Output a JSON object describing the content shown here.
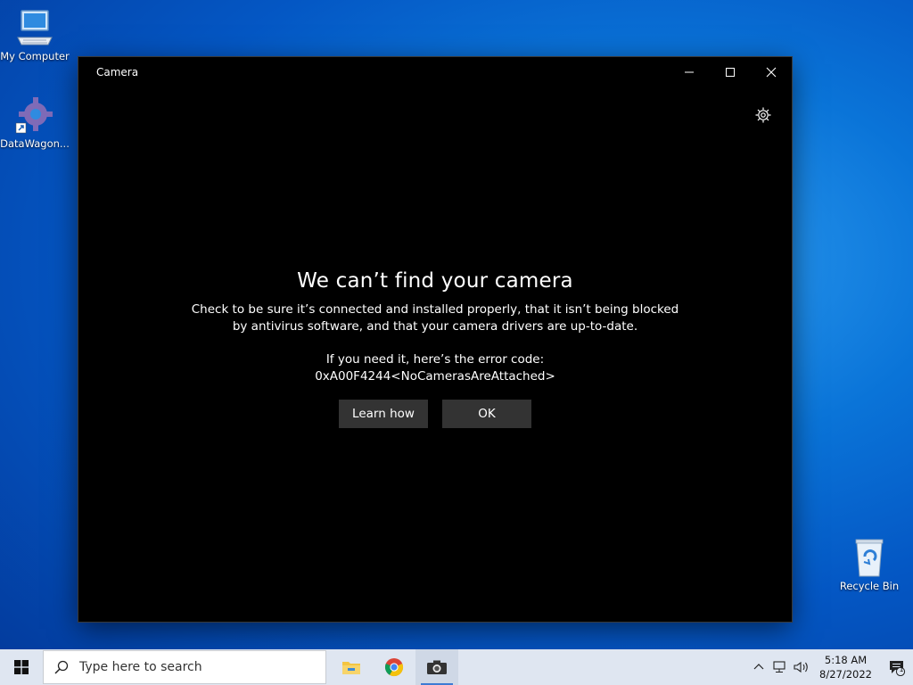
{
  "desktop": {
    "icons": [
      {
        "label": "My Computer"
      },
      {
        "label": "DataWagon..."
      },
      {
        "label": "Recycle Bin"
      }
    ]
  },
  "window": {
    "title": "Camera",
    "heading": "We can’t find your camera",
    "message_line1": "Check to be sure it’s connected and installed properly, that it isn’t being blocked",
    "message_line2": "by antivirus software, and that your camera drivers are up-to-date.",
    "error_intro": "If you need it, here’s the error code:",
    "error_code": "0xA00F4244<NoCamerasAreAttached>",
    "learn_how_label": "Learn how",
    "ok_label": "OK"
  },
  "taskbar": {
    "search_placeholder": "Type here to search",
    "pinned_apps": [
      "file-explorer-icon",
      "chrome-icon",
      "camera-icon"
    ],
    "clock_time": "5:18 AM",
    "clock_date": "8/27/2022",
    "notification_count": "1"
  },
  "colors": {
    "accent": "#3d7bd4",
    "window_bg": "#000000",
    "button_bg": "#333333",
    "taskbar_bg": "#dfe6f1"
  }
}
